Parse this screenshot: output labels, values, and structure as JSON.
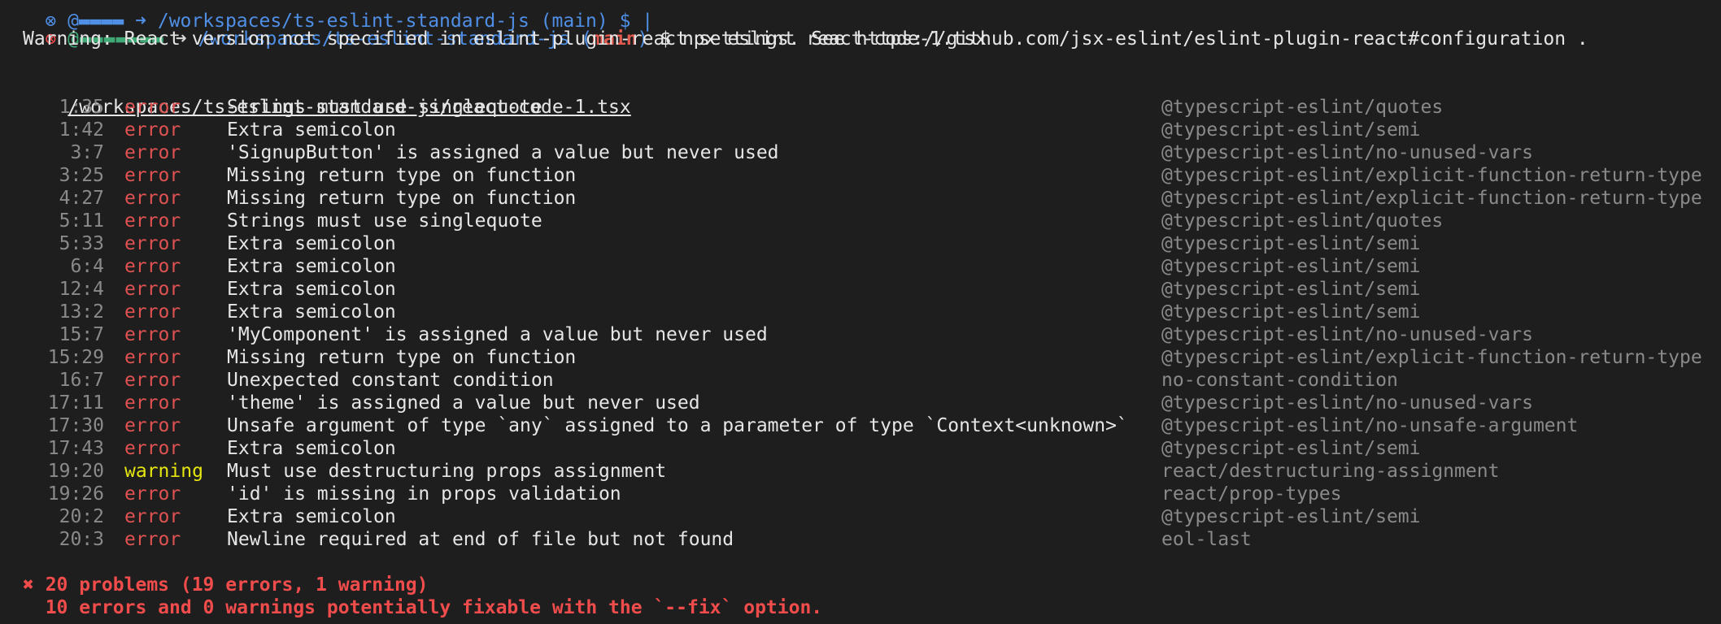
{
  "prev_line": {
    "text": "⊗ @▬▬▬▬ ➜ /workspaces/ts-eslint-standard-js (main) $ |"
  },
  "prompt": {
    "status_icon": "⊗",
    "user": "@▬▬▬▬▬▬▬",
    "arrow": "➜",
    "path": "/workspaces/ts-eslint-standard-js",
    "branch_open": "(",
    "branch": "main",
    "branch_close": ")",
    "command": "$ npx eslint react-code-1.tsx"
  },
  "warning_text": "Warning: React version not specified in eslint-plugin-react settings. See https://github.com/jsx-eslint/eslint-plugin-react#configuration .",
  "file_path": "/workspaces/ts-eslint-standard-js/react-code-1.tsx",
  "problems": [
    {
      "loc": "1:35",
      "severity": "error",
      "message": "Strings must use singlequote",
      "rule": "@typescript-eslint/quotes"
    },
    {
      "loc": "1:42",
      "severity": "error",
      "message": "Extra semicolon",
      "rule": "@typescript-eslint/semi"
    },
    {
      "loc": "3:7",
      "severity": "error",
      "message": "'SignupButton' is assigned a value but never used",
      "rule": "@typescript-eslint/no-unused-vars"
    },
    {
      "loc": "3:25",
      "severity": "error",
      "message": "Missing return type on function",
      "rule": "@typescript-eslint/explicit-function-return-type"
    },
    {
      "loc": "4:27",
      "severity": "error",
      "message": "Missing return type on function",
      "rule": "@typescript-eslint/explicit-function-return-type"
    },
    {
      "loc": "5:11",
      "severity": "error",
      "message": "Strings must use singlequote",
      "rule": "@typescript-eslint/quotes"
    },
    {
      "loc": "5:33",
      "severity": "error",
      "message": "Extra semicolon",
      "rule": "@typescript-eslint/semi"
    },
    {
      "loc": "6:4",
      "severity": "error",
      "message": "Extra semicolon",
      "rule": "@typescript-eslint/semi"
    },
    {
      "loc": "12:4",
      "severity": "error",
      "message": "Extra semicolon",
      "rule": "@typescript-eslint/semi"
    },
    {
      "loc": "13:2",
      "severity": "error",
      "message": "Extra semicolon",
      "rule": "@typescript-eslint/semi"
    },
    {
      "loc": "15:7",
      "severity": "error",
      "message": "'MyComponent' is assigned a value but never used",
      "rule": "@typescript-eslint/no-unused-vars"
    },
    {
      "loc": "15:29",
      "severity": "error",
      "message": "Missing return type on function",
      "rule": "@typescript-eslint/explicit-function-return-type"
    },
    {
      "loc": "16:7",
      "severity": "error",
      "message": "Unexpected constant condition",
      "rule": "no-constant-condition"
    },
    {
      "loc": "17:11",
      "severity": "error",
      "message": "'theme' is assigned a value but never used",
      "rule": "@typescript-eslint/no-unused-vars"
    },
    {
      "loc": "17:30",
      "severity": "error",
      "message": "Unsafe argument of type `any` assigned to a parameter of type `Context<unknown>`",
      "rule": "@typescript-eslint/no-unsafe-argument"
    },
    {
      "loc": "17:43",
      "severity": "error",
      "message": "Extra semicolon",
      "rule": "@typescript-eslint/semi"
    },
    {
      "loc": "19:20",
      "severity": "warning",
      "message": "Must use destructuring props assignment",
      "rule": "react/destructuring-assignment"
    },
    {
      "loc": "19:26",
      "severity": "error",
      "message": "'id' is missing in props validation",
      "rule": "react/prop-types"
    },
    {
      "loc": "20:2",
      "severity": "error",
      "message": "Extra semicolon",
      "rule": "@typescript-eslint/semi"
    },
    {
      "loc": "20:3",
      "severity": "error",
      "message": "Newline required at end of file but not found",
      "rule": "eol-last"
    }
  ],
  "summary": {
    "line1": "✖ 20 problems (19 errors, 1 warning)",
    "line2": "  10 errors and 0 warnings potentially fixable with the `--fix` option."
  },
  "colors": {
    "background": "#1e1e1e",
    "error": "#e05252",
    "warning": "#e5e510",
    "path": "#4f8fe6",
    "branch": "#e05a4f",
    "dim": "#8a8a8a"
  }
}
